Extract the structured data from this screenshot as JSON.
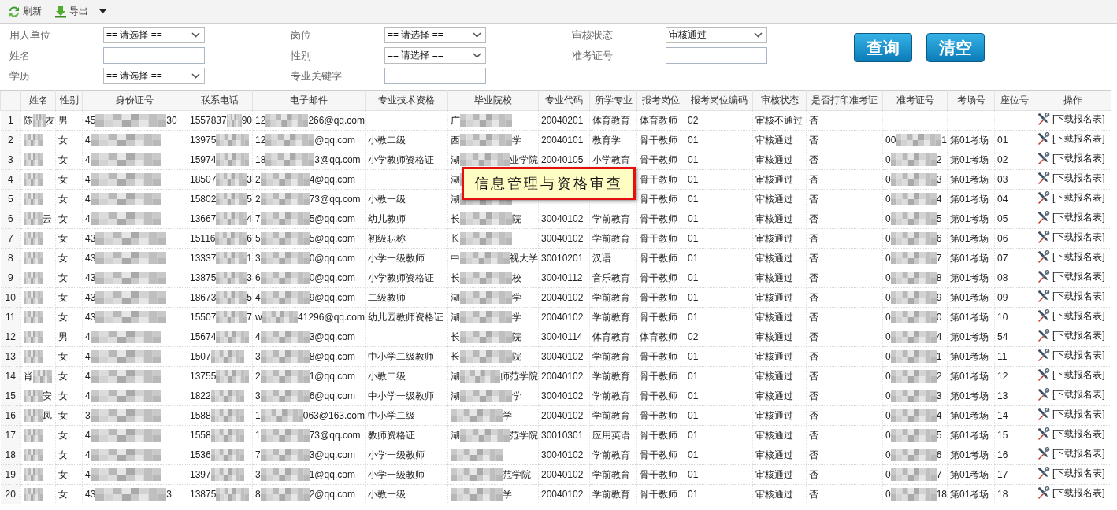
{
  "toolbar": [
    {
      "kind": "refresh",
      "label": "刷新"
    },
    {
      "kind": "export",
      "label": "导出",
      "dropdown": true
    }
  ],
  "filter_columns": [
    [
      {
        "label": "用人单位",
        "kind": "select",
        "value": "== 请选择 =="
      },
      {
        "label": "姓名",
        "kind": "input"
      },
      {
        "label": "学历",
        "kind": "select",
        "value": "== 请选择 =="
      }
    ],
    [
      {
        "label": "岗位",
        "kind": "select",
        "value": "== 请选择 =="
      },
      {
        "label": "性别",
        "kind": "select",
        "value": "== 请选择 =="
      },
      {
        "label": "专业关键字",
        "kind": "input"
      }
    ],
    [
      {
        "label": "审核状态",
        "kind": "select",
        "value": "审核通过"
      },
      {
        "label": "准考证号",
        "kind": "input"
      }
    ]
  ],
  "buttons": [
    "查询",
    "清空"
  ],
  "table": {
    "columns": [
      "姓名",
      "性别",
      "身份证号",
      "联系电话",
      "电子邮件",
      "专业技术资格",
      "毕业院校",
      "专业代码",
      "所学专业",
      "报考岗位",
      "报考岗位编码",
      "审核状态",
      "是否打印准考证",
      "准考证号",
      "考场号",
      "座位号",
      "操作"
    ],
    "rows": [
      {
        "no": "1",
        "name": {
          "redacted": true,
          "start": "陈",
          "end": "友"
        },
        "gender": "男",
        "id_number": {
          "redacted": true,
          "start": "45",
          "end": "30"
        },
        "phone": {
          "redacted": true,
          "start": "1557837",
          "end": "90"
        },
        "email": {
          "redacted": true,
          "start": "12",
          "end": "266@qq.com"
        },
        "school": {
          "redacted": true,
          "start": "广"
        },
        "major_code": "20040201",
        "major": "体育教育",
        "position": "体育教师",
        "position_code": "02",
        "status": "审核不通过",
        "printed": "否",
        "action": "[下载报名表]"
      },
      {
        "no": "2",
        "name": {
          "redacted": true
        },
        "gender": "女",
        "id_number": {
          "redacted": true,
          "start": "4"
        },
        "phone": {
          "redacted": true,
          "start": "13975"
        },
        "email": {
          "redacted": true,
          "start": "12",
          "end": "@qq.com"
        },
        "qualification": "小教二级",
        "school": {
          "redacted": true,
          "start": "西",
          "end": "学"
        },
        "major_code": "20040101",
        "major": "教育学",
        "position": "骨干教师",
        "position_code": "01",
        "status": "审核通过",
        "printed": "否",
        "ticket": {
          "redacted": true,
          "start": "00",
          "end": "1"
        },
        "room": "第01考场",
        "seat": "01",
        "action": "[下载报名表]"
      },
      {
        "no": "3",
        "name": {
          "redacted": true
        },
        "gender": "女",
        "id_number": {
          "redacted": true,
          "start": "4"
        },
        "phone": {
          "redacted": true,
          "start": "15974"
        },
        "email": {
          "redacted": true,
          "start": "18",
          "end": "3@qq.com"
        },
        "qualification": "小学教师资格证",
        "school": {
          "redacted": true,
          "start": "湖",
          "end": "业学院"
        },
        "major_code": "20040105",
        "major": "小学教育",
        "position": "骨干教师",
        "position_code": "01",
        "status": "审核通过",
        "printed": "否",
        "ticket": {
          "redacted": true,
          "start": "0",
          "end": "2"
        },
        "room": "第01考场",
        "seat": "02",
        "action": "[下载报名表]"
      },
      {
        "no": "4",
        "name": {
          "redacted": true
        },
        "gender": "女",
        "id_number": {
          "redacted": true,
          "start": "4"
        },
        "phone": {
          "redacted": true,
          "start": "18507",
          "end": "3"
        },
        "email": {
          "redacted": true,
          "start": "2",
          "end": "4@qq.com"
        },
        "school": {
          "redacted": true,
          "start": "湖"
        },
        "position": "骨干教师",
        "position_code": "01",
        "status": "审核通过",
        "printed": "否",
        "ticket": {
          "redacted": true,
          "start": "0",
          "end": "3"
        },
        "room": "第01考场",
        "seat": "03",
        "action": "[下载报名表]"
      },
      {
        "no": "5",
        "name": {
          "redacted": true
        },
        "gender": "女",
        "id_number": {
          "redacted": true,
          "start": "4"
        },
        "phone": {
          "redacted": true,
          "start": "15802",
          "end": "5"
        },
        "email": {
          "redacted": true,
          "start": "2",
          "end": "73@qq.com"
        },
        "qualification": "小教一级",
        "school": {
          "redacted": true,
          "start": "湖"
        },
        "position": "骨干教师",
        "position_code": "01",
        "status": "审核通过",
        "printed": "否",
        "ticket": {
          "redacted": true,
          "start": "0",
          "end": "4"
        },
        "room": "第01考场",
        "seat": "04",
        "action": "[下载报名表]"
      },
      {
        "no": "6",
        "name": {
          "redacted": true,
          "end": "云"
        },
        "gender": "女",
        "id_number": {
          "redacted": true,
          "start": "4"
        },
        "phone": {
          "redacted": true,
          "start": "13667",
          "end": "4"
        },
        "email": {
          "redacted": true,
          "start": "7",
          "end": "5@qq.com"
        },
        "qualification": "幼儿教师",
        "school": {
          "redacted": true,
          "start": "长",
          "end": "院"
        },
        "major_code": "30040102",
        "major": "学前教育",
        "position": "骨干教师",
        "position_code": "01",
        "status": "审核通过",
        "printed": "否",
        "ticket": {
          "redacted": true,
          "start": "0",
          "end": "5"
        },
        "room": "第01考场",
        "seat": "05",
        "action": "[下载报名表]"
      },
      {
        "no": "7",
        "name": {
          "redacted": true
        },
        "gender": "女",
        "id_number": {
          "redacted": true,
          "start": "43"
        },
        "phone": {
          "redacted": true,
          "start": "15116",
          "end": "6"
        },
        "email": {
          "redacted": true,
          "start": "5",
          "end": "5@qq.com"
        },
        "qualification": "初级职称",
        "school": {
          "redacted": true,
          "start": "长"
        },
        "major_code": "30040102",
        "major": "学前教育",
        "position": "骨干教师",
        "position_code": "01",
        "status": "审核通过",
        "printed": "否",
        "ticket": {
          "redacted": true,
          "start": "0",
          "end": "6"
        },
        "room": "第01考场",
        "seat": "06",
        "action": "[下载报名表]"
      },
      {
        "no": "8",
        "name": {
          "redacted": true
        },
        "gender": "女",
        "id_number": {
          "redacted": true,
          "start": "43"
        },
        "phone": {
          "redacted": true,
          "start": "13337",
          "end": "1"
        },
        "email": {
          "redacted": true,
          "start": "3",
          "end": "0@qq.com"
        },
        "qualification": "小学一级教师",
        "school": {
          "redacted": true,
          "start": "中",
          "end": "视大学"
        },
        "major_code": "30010201",
        "major": "汉语",
        "position": "骨干教师",
        "position_code": "01",
        "status": "审核通过",
        "printed": "否",
        "ticket": {
          "redacted": true,
          "start": "0",
          "end": "7"
        },
        "room": "第01考场",
        "seat": "07",
        "action": "[下载报名表]"
      },
      {
        "no": "9",
        "name": {
          "redacted": true
        },
        "gender": "女",
        "id_number": {
          "redacted": true,
          "start": "43"
        },
        "phone": {
          "redacted": true,
          "start": "13875",
          "end": "3"
        },
        "email": {
          "redacted": true,
          "start": "6",
          "end": "0@qq.com"
        },
        "qualification": "小学教师资格证",
        "school": {
          "redacted": true,
          "start": "长",
          "end": "校"
        },
        "major_code": "30040112",
        "major": "音乐教育",
        "position": "骨干教师",
        "position_code": "01",
        "status": "审核通过",
        "printed": "否",
        "ticket": {
          "redacted": true,
          "start": "0",
          "end": "8"
        },
        "room": "第01考场",
        "seat": "08",
        "action": "[下载报名表]"
      },
      {
        "no": "10",
        "name": {
          "redacted": true
        },
        "gender": "女",
        "id_number": {
          "redacted": true,
          "start": "43"
        },
        "phone": {
          "redacted": true,
          "start": "18673",
          "end": "5"
        },
        "email": {
          "redacted": true,
          "start": "4",
          "end": "9@qq.com"
        },
        "qualification": "二级教师",
        "school": {
          "redacted": true,
          "start": "湖",
          "end": "学"
        },
        "major_code": "20040102",
        "major": "学前教育",
        "position": "骨干教师",
        "position_code": "01",
        "status": "审核通过",
        "printed": "否",
        "ticket": {
          "redacted": true,
          "start": "0",
          "end": "9"
        },
        "room": "第01考场",
        "seat": "09",
        "action": "[下载报名表]"
      },
      {
        "no": "11",
        "name": {
          "redacted": true
        },
        "gender": "女",
        "id_number": {
          "redacted": true,
          "start": "43"
        },
        "phone": {
          "redacted": true,
          "start": "15507",
          "end": "7"
        },
        "email": {
          "redacted": true,
          "start": "w",
          "end": "41296@qq.com"
        },
        "qualification": "幼儿园教师资格证",
        "school": {
          "redacted": true,
          "start": "湖",
          "end": "学"
        },
        "major_code": "20040102",
        "major": "学前教育",
        "position": "骨干教师",
        "position_code": "01",
        "status": "审核通过",
        "printed": "否",
        "ticket": {
          "redacted": true,
          "start": "0",
          "end": "0"
        },
        "room": "第01考场",
        "seat": "10",
        "action": "[下载报名表]"
      },
      {
        "no": "12",
        "name": {
          "redacted": true
        },
        "gender": "男",
        "id_number": {
          "redacted": true,
          "start": "4"
        },
        "phone": {
          "redacted": true,
          "start": "15674"
        },
        "email": {
          "redacted": true,
          "start": "4",
          "end": "3@qq.com"
        },
        "school": {
          "redacted": true,
          "start": "长",
          "end": "院"
        },
        "major_code": "30040114",
        "major": "体育教育",
        "position": "体育教师",
        "position_code": "02",
        "status": "审核通过",
        "printed": "否",
        "ticket": {
          "redacted": true,
          "start": "0",
          "end": "4"
        },
        "room": "第01考场",
        "seat": "54",
        "action": "[下载报名表]"
      },
      {
        "no": "13",
        "name": {
          "redacted": true
        },
        "gender": "女",
        "id_number": {
          "redacted": true,
          "start": "4"
        },
        "phone": {
          "redacted": true,
          "start": "1507"
        },
        "email": {
          "redacted": true,
          "start": "3",
          "end": "8@qq.com"
        },
        "qualification": "中小学二级教师",
        "school": {
          "redacted": true,
          "start": "长",
          "end": "院"
        },
        "major_code": "30040102",
        "major": "学前教育",
        "position": "骨干教师",
        "position_code": "01",
        "status": "审核通过",
        "printed": "否",
        "ticket": {
          "redacted": true,
          "start": "0",
          "end": "1"
        },
        "room": "第01考场",
        "seat": "11",
        "action": "[下载报名表]"
      },
      {
        "no": "14",
        "name": {
          "redacted": true,
          "start": "肖"
        },
        "gender": "女",
        "id_number": {
          "redacted": true,
          "start": "4"
        },
        "phone": {
          "redacted": true,
          "start": "13755"
        },
        "email": {
          "redacted": true,
          "start": "2",
          "end": "1@qq.com"
        },
        "qualification": "小教二级",
        "school": {
          "redacted": true,
          "start": "湖",
          "end": "师范学院"
        },
        "major_code": "20040102",
        "major": "学前教育",
        "position": "骨干教师",
        "position_code": "01",
        "status": "审核通过",
        "printed": "否",
        "ticket": {
          "redacted": true,
          "start": "0",
          "end": "2"
        },
        "room": "第01考场",
        "seat": "12",
        "action": "[下载报名表]"
      },
      {
        "no": "15",
        "name": {
          "redacted": true,
          "end": "安"
        },
        "gender": "女",
        "id_number": {
          "redacted": true,
          "start": "4"
        },
        "phone": {
          "redacted": true,
          "start": "1822"
        },
        "email": {
          "redacted": true,
          "start": "3",
          "end": "6@qq.com"
        },
        "qualification": "中小学一级教师",
        "school": {
          "redacted": true,
          "start": "湖",
          "end": "学"
        },
        "major_code": "30040102",
        "major": "学前教育",
        "position": "骨干教师",
        "position_code": "01",
        "status": "审核通过",
        "printed": "否",
        "ticket": {
          "redacted": true,
          "start": "0",
          "end": "3"
        },
        "room": "第01考场",
        "seat": "13",
        "action": "[下载报名表]"
      },
      {
        "no": "16",
        "name": {
          "redacted": true,
          "end": "凤"
        },
        "gender": "女",
        "id_number": {
          "redacted": true,
          "start": "3"
        },
        "phone": {
          "redacted": true,
          "start": "1588"
        },
        "email": {
          "redacted": true,
          "start": "1",
          "end": "063@163.com"
        },
        "qualification": "中小学二级",
        "school": {
          "redacted": true,
          "end": "学"
        },
        "major_code": "20040102",
        "major": "学前教育",
        "position": "骨干教师",
        "position_code": "01",
        "status": "审核通过",
        "printed": "否",
        "ticket": {
          "redacted": true,
          "start": "0",
          "end": "4"
        },
        "room": "第01考场",
        "seat": "14",
        "action": "[下载报名表]"
      },
      {
        "no": "17",
        "name": {
          "redacted": true
        },
        "gender": "女",
        "id_number": {
          "redacted": true,
          "start": "4"
        },
        "phone": {
          "redacted": true,
          "start": "1558"
        },
        "email": {
          "redacted": true,
          "start": "1",
          "end": "73@qq.com"
        },
        "qualification": "教师资格证",
        "school": {
          "redacted": true,
          "start": "湖",
          "end": "范学院"
        },
        "major_code": "30010301",
        "major": "应用英语",
        "position": "骨干教师",
        "position_code": "01",
        "status": "审核通过",
        "printed": "否",
        "ticket": {
          "redacted": true,
          "start": "0",
          "end": "5"
        },
        "room": "第01考场",
        "seat": "15",
        "action": "[下载报名表]"
      },
      {
        "no": "18",
        "name": {
          "redacted": true
        },
        "gender": "女",
        "id_number": {
          "redacted": true,
          "start": "4"
        },
        "phone": {
          "redacted": true,
          "start": "1536"
        },
        "email": {
          "redacted": true,
          "start": "7",
          "end": "3@qq.com"
        },
        "qualification": "小学一级教师",
        "school": {
          "redacted": true
        },
        "major_code": "30040102",
        "major": "学前教育",
        "position": "骨干教师",
        "position_code": "01",
        "status": "审核通过",
        "printed": "否",
        "ticket": {
          "redacted": true,
          "start": "0",
          "end": "6"
        },
        "room": "第01考场",
        "seat": "16",
        "action": "[下载报名表]"
      },
      {
        "no": "19",
        "name": {
          "redacted": true
        },
        "gender": "女",
        "id_number": {
          "redacted": true,
          "start": "4"
        },
        "phone": {
          "redacted": true,
          "start": "1397"
        },
        "email": {
          "redacted": true,
          "start": "3",
          "end": "1@qq.com"
        },
        "qualification": "小学一级教师",
        "school": {
          "redacted": true,
          "end": "范学院"
        },
        "major_code": "20040102",
        "major": "学前教育",
        "position": "骨干教师",
        "position_code": "01",
        "status": "审核通过",
        "printed": "否",
        "ticket": {
          "redacted": true,
          "start": "0",
          "end": "7"
        },
        "room": "第01考场",
        "seat": "17",
        "action": "[下载报名表]"
      },
      {
        "no": "20",
        "name": {
          "redacted": true
        },
        "gender": "女",
        "id_number": {
          "redacted": true,
          "start": "43",
          "end": "3"
        },
        "phone": {
          "redacted": true,
          "start": "13875"
        },
        "email": {
          "redacted": true,
          "start": "8",
          "end": "2@qq.com"
        },
        "qualification": "小教一级",
        "school": {
          "redacted": true,
          "end": "学"
        },
        "major_code": "20040102",
        "major": "学前教育",
        "position": "骨干教师",
        "position_code": "01",
        "status": "审核通过",
        "printed": "否",
        "ticket": {
          "redacted": true,
          "start": "0",
          "end": "18"
        },
        "room": "第01考场",
        "seat": "18",
        "action": "[下载报名表]"
      }
    ]
  },
  "callout": "信息管理与资格审查"
}
